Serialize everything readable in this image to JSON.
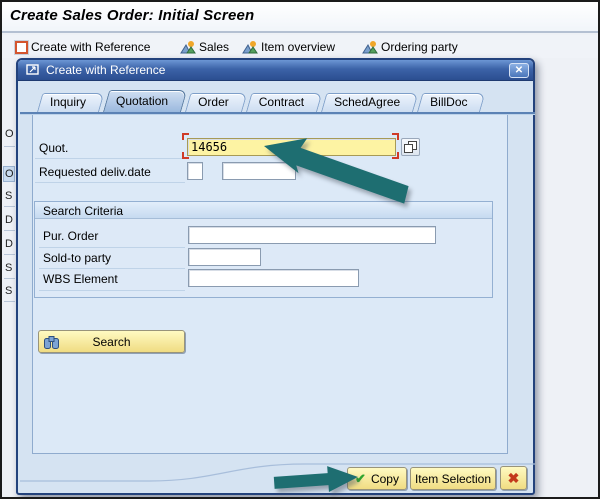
{
  "window": {
    "title": "Create Sales Order: Initial Screen"
  },
  "toolbar": {
    "items": [
      {
        "label": "Create with Reference",
        "icon": "create-with-reference-icon"
      },
      {
        "label": "Sales",
        "icon": "mountains-icon"
      },
      {
        "label": "Item overview",
        "icon": "mountains-icon"
      },
      {
        "label": "Ordering party",
        "icon": "mountains-icon"
      }
    ]
  },
  "background_screen": {
    "left_edge_fragments": [
      "O",
      "O",
      "S",
      "D",
      "D",
      "S",
      "S"
    ]
  },
  "dialog": {
    "title": "Create with Reference",
    "close_glyph": "✕",
    "tabs": [
      {
        "label": "Inquiry",
        "active": false
      },
      {
        "label": "Quotation",
        "active": true
      },
      {
        "label": "Order",
        "active": false
      },
      {
        "label": "Contract",
        "active": false
      },
      {
        "label": "SchedAgree",
        "active": false
      },
      {
        "label": "BillDoc",
        "active": false
      }
    ],
    "fields": {
      "quot": {
        "label": "Quot.",
        "value": "14656"
      },
      "requested_deliv_date": {
        "label": "Requested deliv.date",
        "value1": "",
        "value2": ""
      }
    },
    "search_criteria": {
      "title": "Search Criteria",
      "fields": [
        {
          "label": "Pur. Order",
          "value": ""
        },
        {
          "label": "Sold-to party",
          "value": ""
        },
        {
          "label": "WBS Element",
          "value": ""
        }
      ]
    },
    "search_button": {
      "label": "Search",
      "icon": "binoculars-icon"
    },
    "footer": {
      "copy_label": "Copy",
      "copy_icon": "green-check-icon",
      "item_selection_label": "Item Selection",
      "cancel_icon": "red-x-icon",
      "cancel_glyph": "✖"
    }
  },
  "annotations": {
    "arrow_1_target": "quotation-number-field",
    "arrow_2_target": "copy-button"
  },
  "colors": {
    "field_highlight_yellow": "#fdf3a3",
    "focus_bracket_red": "#cf3b28",
    "arrow_teal": "#1e6e71",
    "titlebar_blue": "#2b4e90",
    "button_yellow": "#f0dc82",
    "cancel_red": "#c3391b",
    "check_green": "#2ea52e",
    "panel_blue": "#dce9f7"
  }
}
